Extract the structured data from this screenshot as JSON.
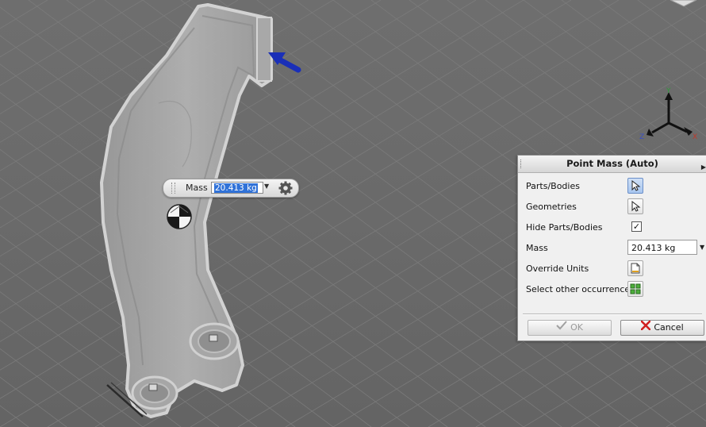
{
  "mini_toolbar": {
    "mass_label": "Mass",
    "mass_value": "20.413 kg"
  },
  "view_cube": {
    "axis_x": "X",
    "axis_y": "Y",
    "axis_z": "Z",
    "colors": {
      "x": "#c0392b",
      "y": "#2e9a3a",
      "z": "#3a4fc4"
    }
  },
  "dialog": {
    "title": "Point Mass (Auto)",
    "rows": {
      "parts_bodies": "Parts/Bodies",
      "geometries": "Geometries",
      "hide_parts_bodies": "Hide Parts/Bodies",
      "mass": "Mass",
      "override_units": "Override Units",
      "select_other": "Select other occurrences"
    },
    "hide_checked": true,
    "mass_value": "20.413 kg",
    "ok_label": "OK",
    "cancel_label": "Cancel"
  },
  "icons": [
    "pointer-icon",
    "gear-icon",
    "point-mass-icon",
    "document-icon",
    "grid-icon",
    "check-icon",
    "cancel-x-icon",
    "force-arrow-icon"
  ]
}
